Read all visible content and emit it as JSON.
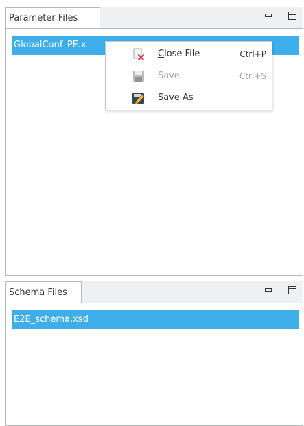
{
  "parameter_files": {
    "tab_label": "Parameter Files",
    "selected_item": "GlobalConf_PE.x"
  },
  "schema_files": {
    "tab_label": "Schema Files",
    "selected_item": "E2E_schema.xsd"
  },
  "context_menu": {
    "close_file": {
      "mnemonic": "C",
      "label_rest": "lose File",
      "shortcut": "Ctrl+P",
      "icon": "close-file-icon"
    },
    "save": {
      "label": "Save",
      "shortcut": "Ctrl+S",
      "enabled": false,
      "icon": "save-icon"
    },
    "save_as": {
      "label": "Save As",
      "icon": "save-as-icon"
    }
  },
  "colors": {
    "selection": "#3daee9",
    "panel_background": "#eff0f1",
    "text": "#31363b",
    "disabled_text": "#a5a6a8"
  }
}
